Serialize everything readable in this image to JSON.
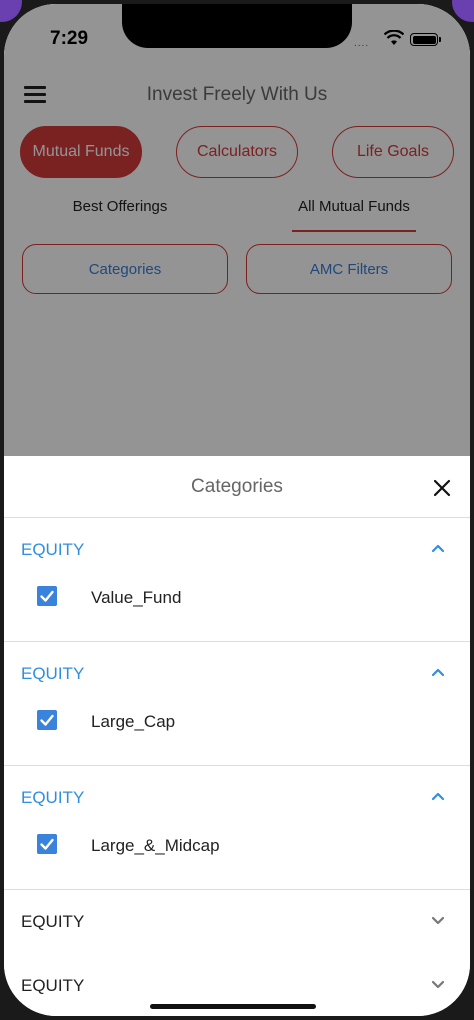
{
  "status": {
    "time": "7:29",
    "signal": "....",
    "wifi_icon": "wifi-icon",
    "battery_icon": "battery-icon"
  },
  "header": {
    "title": "Invest Freely With Us",
    "menu_icon": "hamburger-icon"
  },
  "tabs": [
    {
      "label": "Mutual Funds",
      "active": true
    },
    {
      "label": "Calculators",
      "active": false
    },
    {
      "label": "Life Goals",
      "active": false
    }
  ],
  "subtabs": [
    {
      "label": "Best Offerings",
      "active": false
    },
    {
      "label": "All Mutual Funds",
      "active": true
    }
  ],
  "filters": {
    "categories": "Categories",
    "amc": "AMC Filters"
  },
  "sheet": {
    "title": "Categories",
    "close_icon": "close-icon",
    "groups": [
      {
        "label": "EQUITY",
        "expanded": true,
        "items": [
          {
            "label": "Value_Fund",
            "checked": true
          }
        ]
      },
      {
        "label": "EQUITY",
        "expanded": true,
        "items": [
          {
            "label": "Large_Cap",
            "checked": true
          }
        ]
      },
      {
        "label": "EQUITY",
        "expanded": true,
        "items": [
          {
            "label": "Large_&_Midcap",
            "checked": true
          }
        ]
      },
      {
        "label": "EQUITY",
        "expanded": false,
        "items": []
      },
      {
        "label": "EQUITY",
        "expanded": false,
        "items": []
      }
    ]
  },
  "colors": {
    "accent": "#d23a3a",
    "link_blue": "#2f8ee0",
    "checkbox": "#3a83dc"
  }
}
